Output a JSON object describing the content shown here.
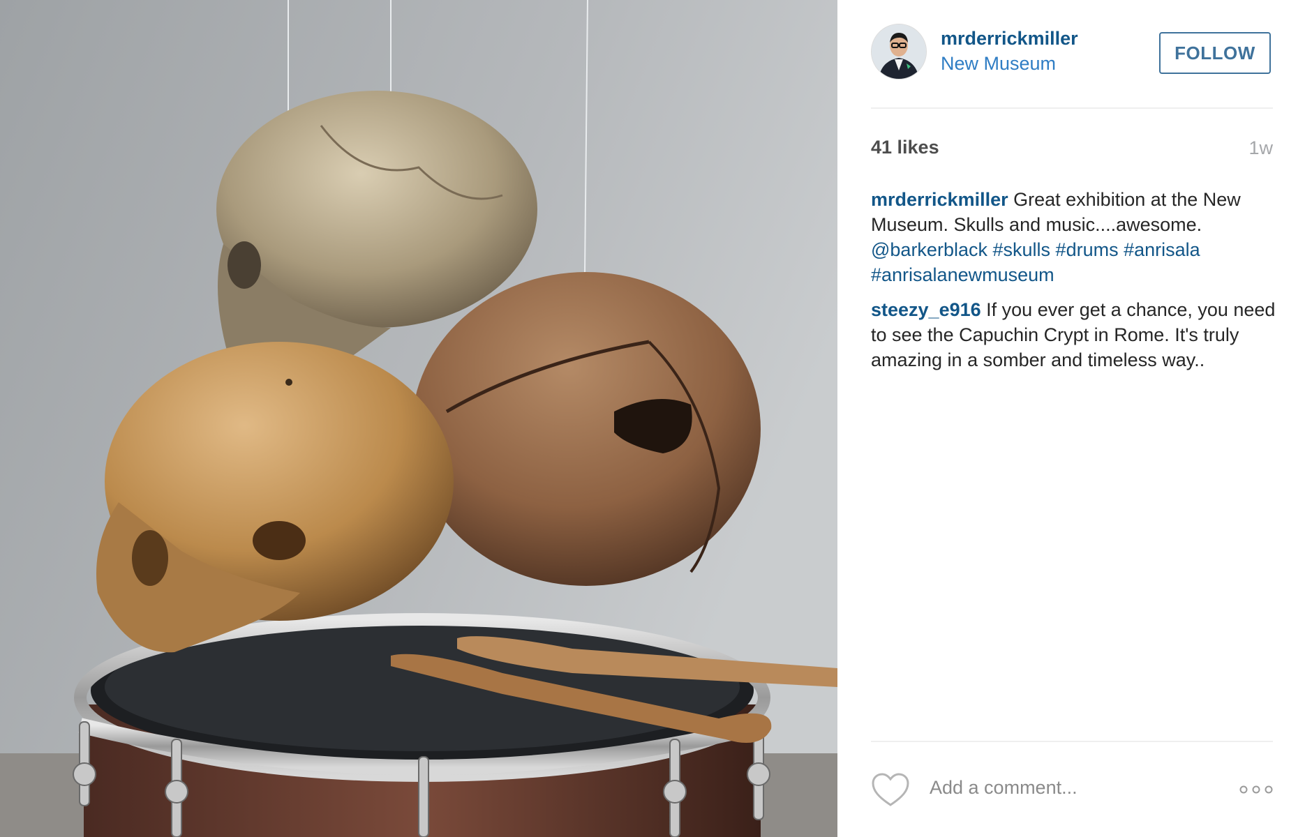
{
  "post": {
    "username": "mrderrickmiller",
    "location": "New Museum",
    "follow_label": "FOLLOW",
    "likes": "41 likes",
    "age": "1w",
    "caption": {
      "user": "mrderrickmiller",
      "text_1": "Great exhibition at the New Museum. Skulls and music....awesome.",
      "tags": [
        "@barkerblack",
        "#skulls",
        "#drums",
        "#anrisala",
        "#anrisalanewmuseum"
      ]
    },
    "comments": [
      {
        "user": "steezy_e916",
        "text": "If you ever get a chance, you need to see the Capuchin Crypt in Rome. It's truly amazing in a somber and timeless way.."
      }
    ],
    "add_comment_placeholder": "Add a comment..."
  },
  "icons": {
    "like": "heart-outline-icon",
    "more": "more-options-icon"
  },
  "colors": {
    "username": "#125688",
    "location": "#2f7dc4",
    "follow_border": "#3f729b",
    "meta_gray": "#a5a7aa",
    "divider": "#efefef"
  }
}
